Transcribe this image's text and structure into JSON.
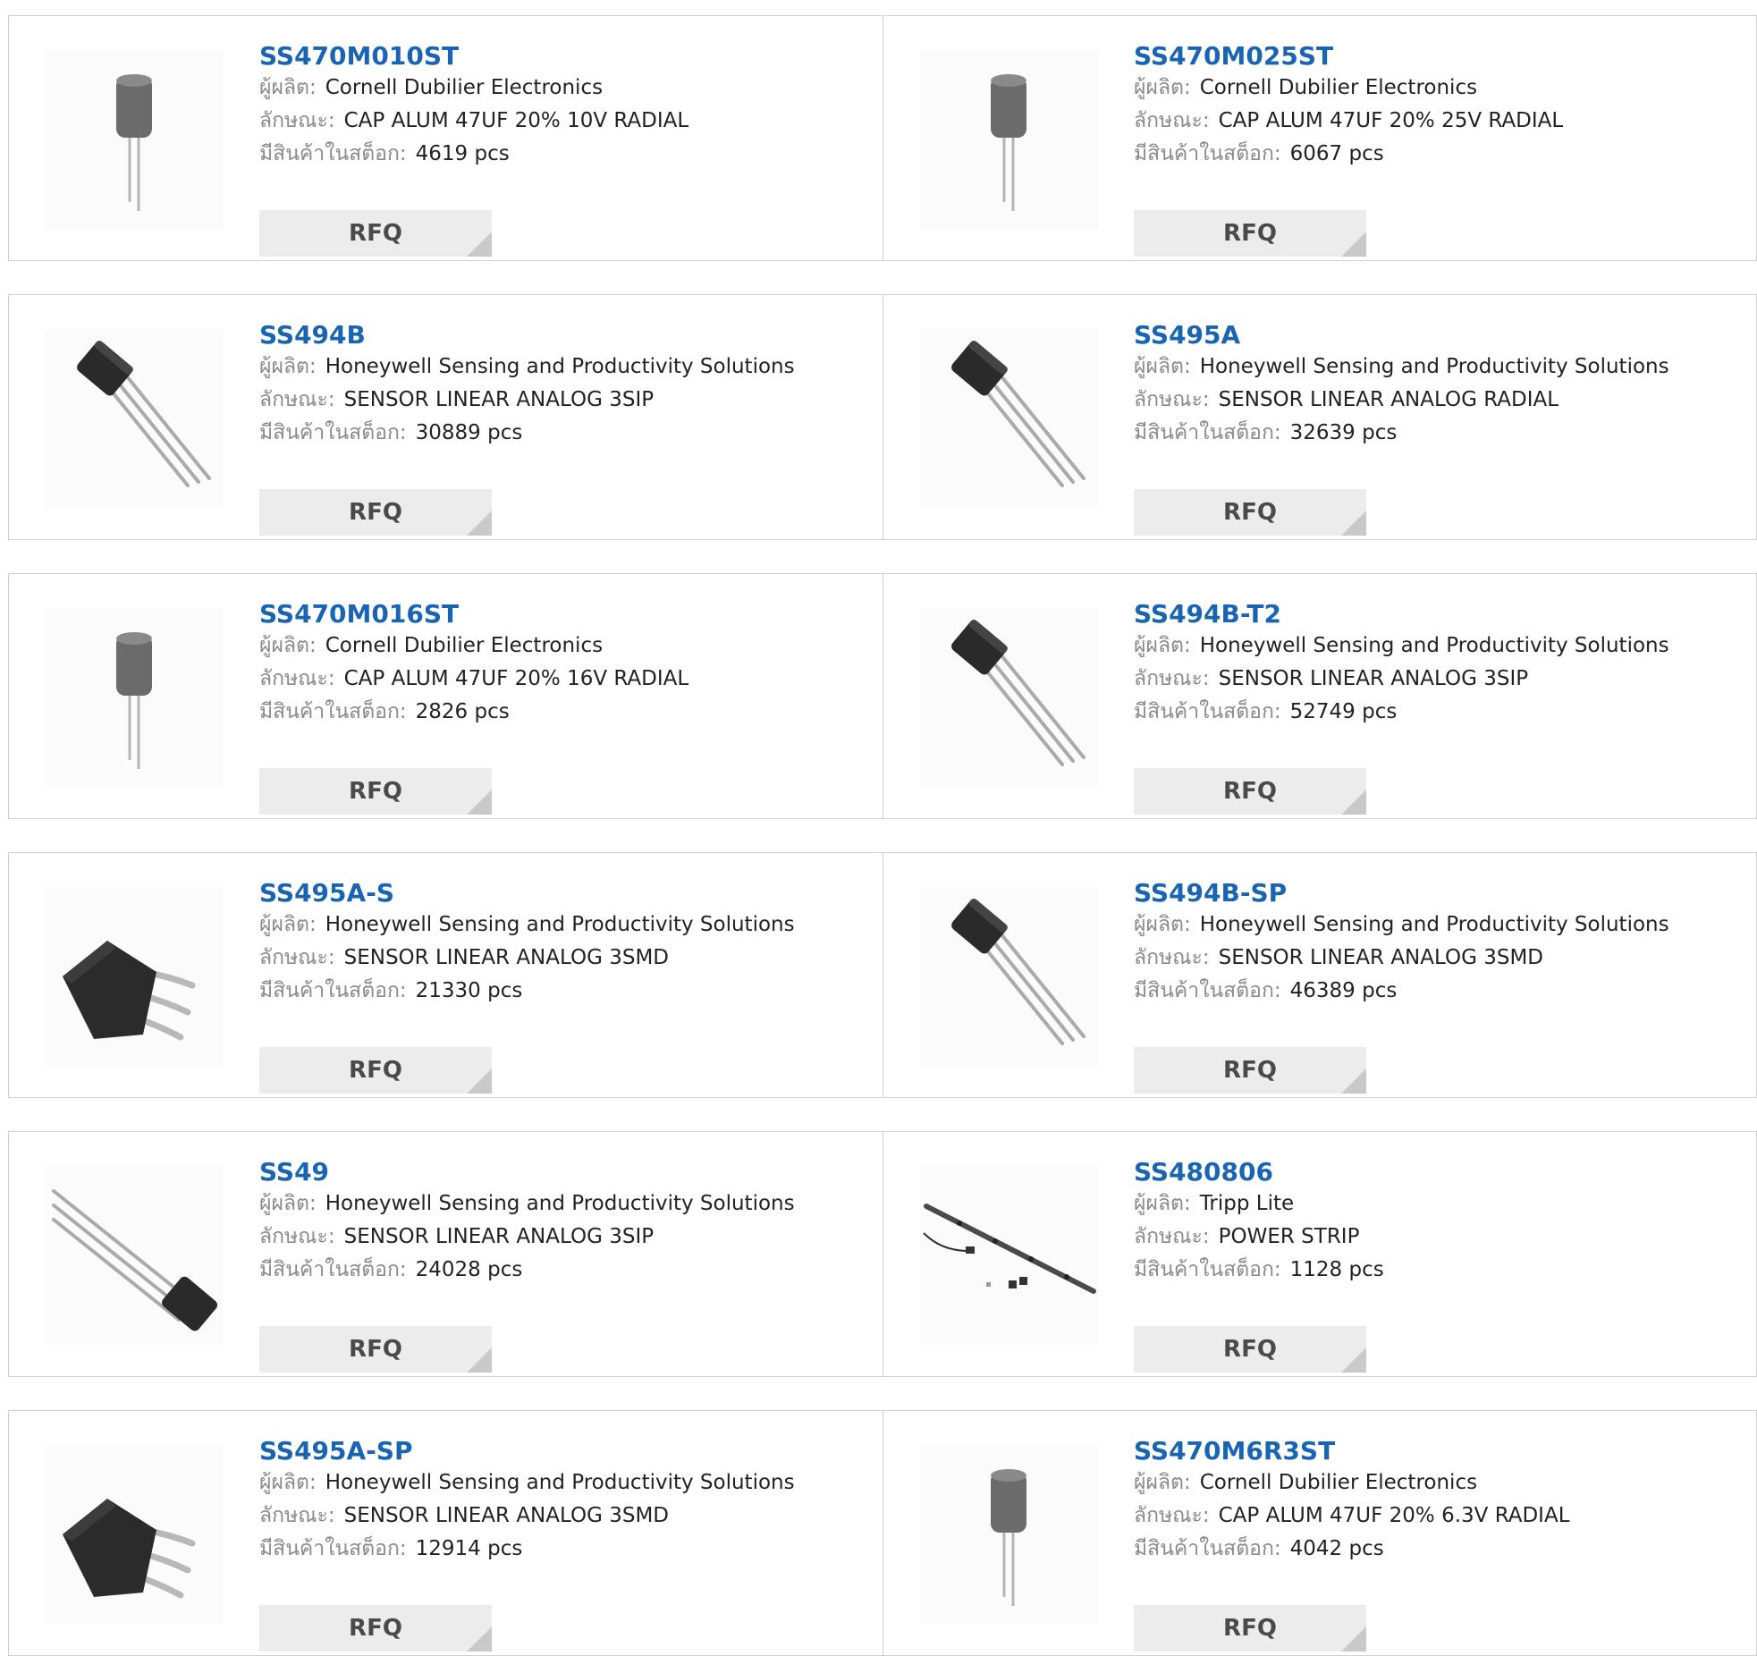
{
  "labels": {
    "manufacturer": "ผู้ผลิต:",
    "description": "ลักษณะ:",
    "stock": "มีสินค้าในสต็อก:",
    "rfq": "RFQ"
  },
  "products": [
    {
      "pn": "SS470M010ST",
      "mfr": "Cornell Dubilier Electronics",
      "desc": "CAP ALUM 47UF 20% 10V RADIAL",
      "stock": "4619 pcs",
      "image": "capacitor-image"
    },
    {
      "pn": "SS470M025ST",
      "mfr": "Cornell Dubilier Electronics",
      "desc": "CAP ALUM 47UF 20% 25V RADIAL",
      "stock": "6067 pcs",
      "image": "capacitor-image"
    },
    {
      "pn": "SS494B",
      "mfr": "Honeywell Sensing and Productivity Solutions",
      "desc": "SENSOR LINEAR ANALOG 3SIP",
      "stock": "30889 pcs",
      "image": "sensor-3sip-image"
    },
    {
      "pn": "SS495A",
      "mfr": "Honeywell Sensing and Productivity Solutions",
      "desc": "SENSOR LINEAR ANALOG RADIAL",
      "stock": "32639 pcs",
      "image": "sensor-3sip-image"
    },
    {
      "pn": "SS470M016ST",
      "mfr": "Cornell Dubilier Electronics",
      "desc": "CAP ALUM 47UF 20% 16V RADIAL",
      "stock": "2826 pcs",
      "image": "capacitor-image"
    },
    {
      "pn": "SS494B-T2",
      "mfr": "Honeywell Sensing and Productivity Solutions",
      "desc": "SENSOR LINEAR ANALOG 3SIP",
      "stock": "52749 pcs",
      "image": "sensor-3sip-image"
    },
    {
      "pn": "SS495A-S",
      "mfr": "Honeywell Sensing and Productivity Solutions",
      "desc": "SENSOR LINEAR ANALOG 3SMD",
      "stock": "21330 pcs",
      "image": "sensor-smd-image"
    },
    {
      "pn": "SS494B-SP",
      "mfr": "Honeywell Sensing and Productivity Solutions",
      "desc": "SENSOR LINEAR ANALOG 3SMD",
      "stock": "46389 pcs",
      "image": "sensor-3sip-image"
    },
    {
      "pn": "SS49",
      "mfr": "Honeywell Sensing and Productivity Solutions",
      "desc": "SENSOR LINEAR ANALOG 3SIP",
      "stock": "24028 pcs",
      "image": "sensor-3sip-flipped-image"
    },
    {
      "pn": "SS480806",
      "mfr": "Tripp Lite",
      "desc": "POWER STRIP",
      "stock": "1128 pcs",
      "image": "power-strip-image"
    },
    {
      "pn": "SS495A-SP",
      "mfr": "Honeywell Sensing and Productivity Solutions",
      "desc": "SENSOR LINEAR ANALOG 3SMD",
      "stock": "12914 pcs",
      "image": "sensor-smd-image"
    },
    {
      "pn": "SS470M6R3ST",
      "mfr": "Cornell Dubilier Electronics",
      "desc": "CAP ALUM 47UF 20% 6.3V RADIAL",
      "stock": "4042 pcs",
      "image": "capacitor-image"
    }
  ],
  "colors": {
    "part_number": "#1a64b4",
    "border": "#cfcfcf",
    "rfq_bg": "#ececec",
    "label": "#8a8a8a"
  }
}
